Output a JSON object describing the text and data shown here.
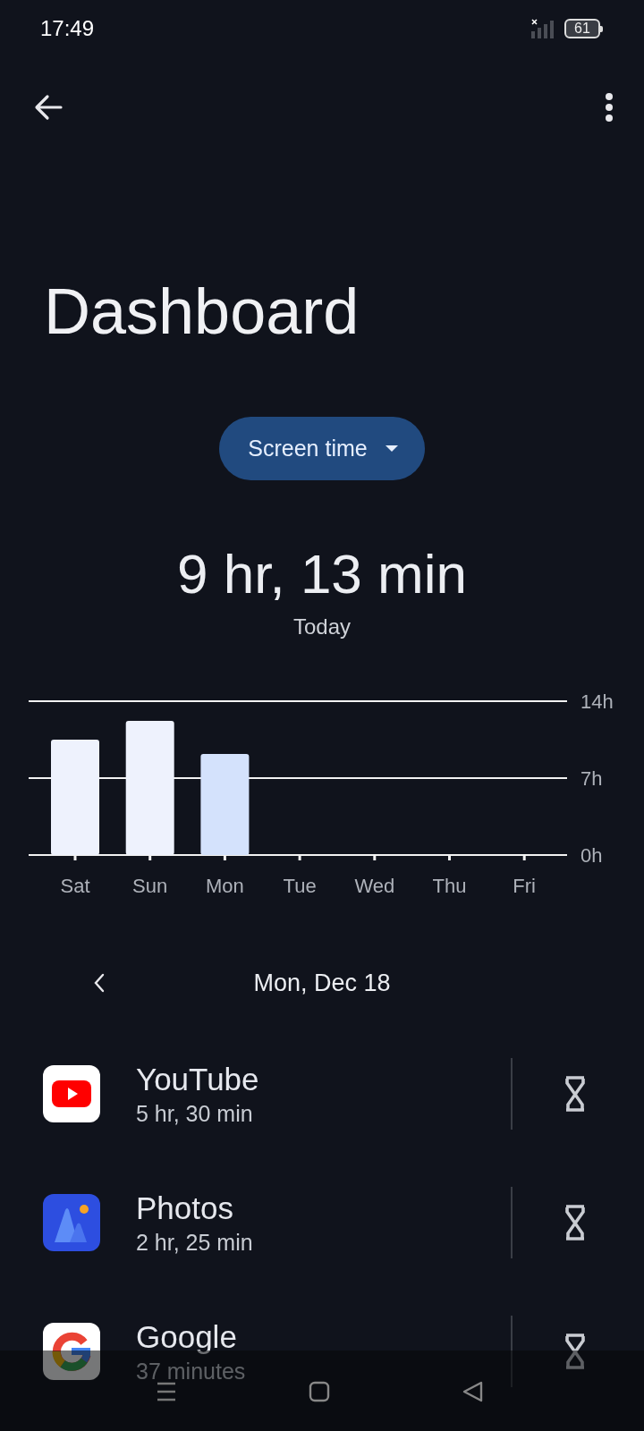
{
  "status_bar": {
    "time": "17:49",
    "battery": "61"
  },
  "title": "Dashboard",
  "metric_selector": {
    "label": "Screen time"
  },
  "summary": {
    "total": "9 hr, 13 min",
    "period": "Today"
  },
  "usage_chart": {
    "chart_data": {
      "type": "bar",
      "categories": [
        "Sat",
        "Sun",
        "Mon",
        "Tue",
        "Wed",
        "Thu",
        "Fri"
      ],
      "series": [
        {
          "color": "#eef2fd",
          "values": [
            10.5,
            12.2,
            null,
            null,
            null,
            null,
            null
          ]
        },
        {
          "color": "#d4e2fc",
          "values": [
            null,
            null,
            9.2,
            null,
            null,
            null,
            null
          ]
        }
      ],
      "stacked": true,
      "ylim": [
        0,
        14
      ],
      "yticks": [
        {
          "value": 0,
          "label": "0h"
        },
        {
          "value": 7,
          "label": "7h"
        },
        {
          "value": 14,
          "label": "14h"
        }
      ]
    }
  },
  "date_nav": {
    "date": "Mon, Dec 18"
  },
  "apps": [
    {
      "kind": "video",
      "name": "YouTube",
      "usage": "5 hr, 30 min"
    },
    {
      "kind": "gallery",
      "name": "Photos",
      "usage": "2 hr, 25 min"
    },
    {
      "kind": "search",
      "name": "Google",
      "usage": "37 minutes"
    }
  ]
}
